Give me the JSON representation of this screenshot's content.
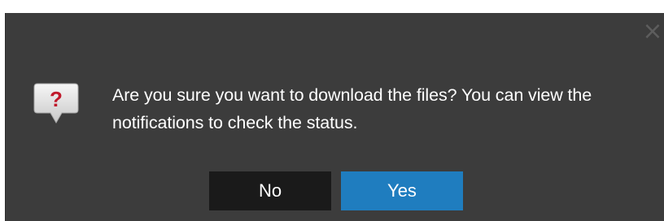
{
  "dialog": {
    "close_glyph": "×",
    "icon": "question-icon",
    "icon_glyph": "?",
    "message": "Are you sure you want to download the files? You can view the notifications to check the status.",
    "buttons": {
      "no_label": "No",
      "yes_label": "Yes"
    },
    "colors": {
      "background": "#3c3c3c",
      "no_button": "#1a1a1a",
      "yes_button": "#1f7dbf",
      "icon_accent": "#c0192b"
    }
  }
}
